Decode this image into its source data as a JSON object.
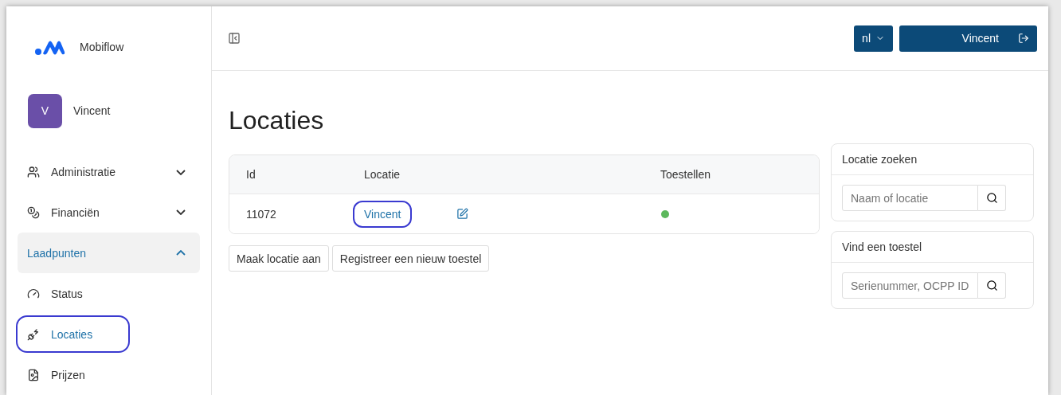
{
  "brand": {
    "name": "Mobiflow"
  },
  "user": {
    "initial": "V",
    "name": "Vincent"
  },
  "sidebar": {
    "items": [
      {
        "label": "Administratie",
        "kind": "group",
        "expanded": false,
        "selected": false,
        "annotated": false
      },
      {
        "label": "Financiën",
        "kind": "group",
        "expanded": false,
        "selected": false,
        "annotated": false
      },
      {
        "label": "Laadpunten",
        "kind": "group",
        "expanded": true,
        "selected": true,
        "annotated": false
      },
      {
        "label": "Status",
        "kind": "link",
        "selected": false,
        "annotated": false
      },
      {
        "label": "Locaties",
        "kind": "link",
        "selected": true,
        "annotated": true
      },
      {
        "label": "Prijzen",
        "kind": "link",
        "selected": false,
        "annotated": false
      }
    ]
  },
  "header": {
    "language": "nl",
    "user_button": "Vincent"
  },
  "page": {
    "title": "Locaties"
  },
  "table": {
    "columns": [
      "Id",
      "Locatie",
      "Toestellen"
    ],
    "rows": [
      {
        "id": "11072",
        "location": "Vincent",
        "annotated": true,
        "color": "#5cb85c"
      }
    ]
  },
  "actions": [
    "Maak locatie aan",
    "Registreer een nieuw toestel"
  ],
  "search_panels": [
    {
      "title": "Locatie zoeken",
      "placeholder": "Naam of locatie"
    },
    {
      "title": "Vind een toestel",
      "placeholder": "Serienummer, OCPP ID"
    }
  ]
}
